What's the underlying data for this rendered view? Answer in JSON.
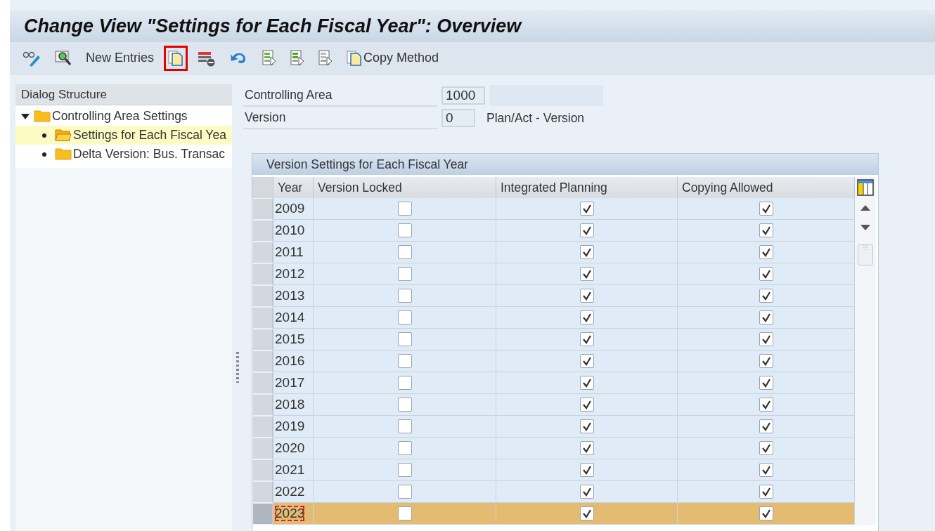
{
  "window": {
    "title": "Change View \"Settings for Each Fiscal Year\": Overview"
  },
  "toolbar": [
    {
      "kind": "glasses",
      "highlighted": false
    },
    {
      "kind": "find",
      "highlighted": false
    },
    {
      "kind": "text",
      "label": "New Entries",
      "highlighted": false
    },
    {
      "kind": "copy",
      "highlighted": true
    },
    {
      "kind": "delete",
      "highlighted": false
    },
    {
      "kind": "undo",
      "highlighted": false
    },
    {
      "kind": "select-all",
      "highlighted": false
    },
    {
      "kind": "select-block",
      "highlighted": false
    },
    {
      "kind": "deselect",
      "highlighted": false
    },
    {
      "kind": "copy-text",
      "label": "Copy Method",
      "highlighted": false
    }
  ],
  "dialog_structure": {
    "title": "Dialog Structure",
    "items": [
      {
        "label": "Controlling Area Settings",
        "expanded": true,
        "selected": false,
        "children": [
          {
            "label": "Settings for Each Fiscal Yea",
            "selected": true
          },
          {
            "label": "Delta Version: Bus. Transac",
            "selected": false
          }
        ]
      }
    ]
  },
  "fields": [
    {
      "label": "Controlling Area",
      "value": "1000"
    },
    {
      "label": "Version",
      "value": "0",
      "description": "Plan/Act - Version"
    }
  ],
  "table": {
    "title": "Version Settings for Each Fiscal Year",
    "columns": [
      "Year",
      "Version Locked",
      "Integrated Planning",
      "Copying Allowed"
    ],
    "rows": [
      {
        "year": "2009",
        "version_locked": false,
        "integrated_planning": true,
        "copying_allowed": true,
        "selected": false,
        "focused": false
      },
      {
        "year": "2010",
        "version_locked": false,
        "integrated_planning": true,
        "copying_allowed": true,
        "selected": false,
        "focused": false
      },
      {
        "year": "2011",
        "version_locked": false,
        "integrated_planning": true,
        "copying_allowed": true,
        "selected": false,
        "focused": false
      },
      {
        "year": "2012",
        "version_locked": false,
        "integrated_planning": true,
        "copying_allowed": true,
        "selected": false,
        "focused": false
      },
      {
        "year": "2013",
        "version_locked": false,
        "integrated_planning": true,
        "copying_allowed": true,
        "selected": false,
        "focused": false
      },
      {
        "year": "2014",
        "version_locked": false,
        "integrated_planning": true,
        "copying_allowed": true,
        "selected": false,
        "focused": false
      },
      {
        "year": "2015",
        "version_locked": false,
        "integrated_planning": true,
        "copying_allowed": true,
        "selected": false,
        "focused": false
      },
      {
        "year": "2016",
        "version_locked": false,
        "integrated_planning": true,
        "copying_allowed": true,
        "selected": false,
        "focused": false
      },
      {
        "year": "2017",
        "version_locked": false,
        "integrated_planning": true,
        "copying_allowed": true,
        "selected": false,
        "focused": false
      },
      {
        "year": "2018",
        "version_locked": false,
        "integrated_planning": true,
        "copying_allowed": true,
        "selected": false,
        "focused": false
      },
      {
        "year": "2019",
        "version_locked": false,
        "integrated_planning": true,
        "copying_allowed": true,
        "selected": false,
        "focused": false
      },
      {
        "year": "2020",
        "version_locked": false,
        "integrated_planning": true,
        "copying_allowed": true,
        "selected": false,
        "focused": false
      },
      {
        "year": "2021",
        "version_locked": false,
        "integrated_planning": true,
        "copying_allowed": true,
        "selected": false,
        "focused": false
      },
      {
        "year": "2022",
        "version_locked": false,
        "integrated_planning": true,
        "copying_allowed": true,
        "selected": false,
        "focused": false
      },
      {
        "year": "2023",
        "version_locked": false,
        "integrated_planning": true,
        "copying_allowed": true,
        "selected": true,
        "focused": true
      }
    ]
  }
}
